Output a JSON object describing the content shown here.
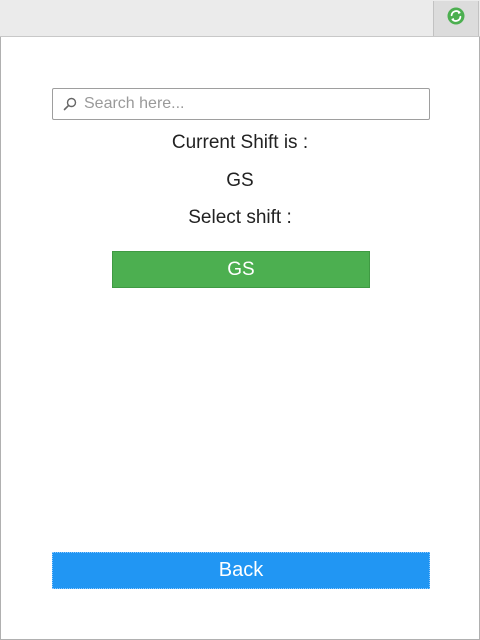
{
  "toolbar": {
    "refresh_icon": "refresh-icon",
    "refresh_color": "#4caf50"
  },
  "search": {
    "placeholder": "Search here...",
    "value": "",
    "icon": "search-icon"
  },
  "shift": {
    "current_label": "Current Shift is :",
    "current_value": "GS",
    "select_label": "Select shift :",
    "options": [
      "GS"
    ],
    "option_color": "#4caf50"
  },
  "footer": {
    "back_label": "Back",
    "back_color": "#2196f3"
  }
}
